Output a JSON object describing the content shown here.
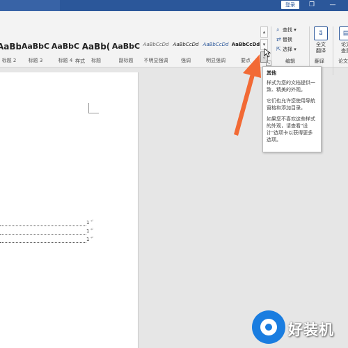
{
  "titlebar": {
    "login_label": "登录",
    "restore_glyph": "❐",
    "minimize_glyph": "—",
    "bg_color": "#2b579a"
  },
  "styles": {
    "items": [
      {
        "preview": "AaBb",
        "name": "标题 2"
      },
      {
        "preview": "AaBbC",
        "name": "标题 3"
      },
      {
        "preview": "AaBbC",
        "name": "标题 4"
      },
      {
        "preview": "AaBb(",
        "name": "标题"
      },
      {
        "preview": "AaBbC",
        "name": "副标题"
      },
      {
        "preview": "AaBbCcDd",
        "name": "不明显强调"
      },
      {
        "preview": "AaBbCcDd",
        "name": "强调"
      },
      {
        "preview": "AaBbCcDd",
        "name": "明显强调"
      },
      {
        "preview": "AaBbCcDd",
        "name": "要点"
      }
    ],
    "group_label": "样式",
    "more_icon": "more-expand-icon"
  },
  "editing": {
    "find_label": "查找",
    "replace_label": "替换",
    "select_label": "选择",
    "group_label": "编辑"
  },
  "translate": {
    "label_line1": "全文",
    "label_line2": "翻译",
    "group_label": "翻译"
  },
  "paper": {
    "label_line1": "论文",
    "label_line2": "查重",
    "group_label": "论文"
  },
  "document": {
    "toc_entries": [
      {
        "page": "1"
      },
      {
        "page": "1"
      },
      {
        "page": "1"
      }
    ],
    "paragraph_mark": "↵"
  },
  "tooltip": {
    "title": "其他",
    "paragraphs": [
      "样式为您的文档提供一致、精美的外观。",
      "它们也允许您使用导航窗格和添加目录。",
      "如果您不喜欢这些样式的外观，请查看\"设计\"选项卡以获得更多选项。"
    ]
  },
  "watermark": {
    "text": "好装机",
    "color": "#1a7de0"
  },
  "annotation": {
    "arrow_color": "#f26a35"
  }
}
